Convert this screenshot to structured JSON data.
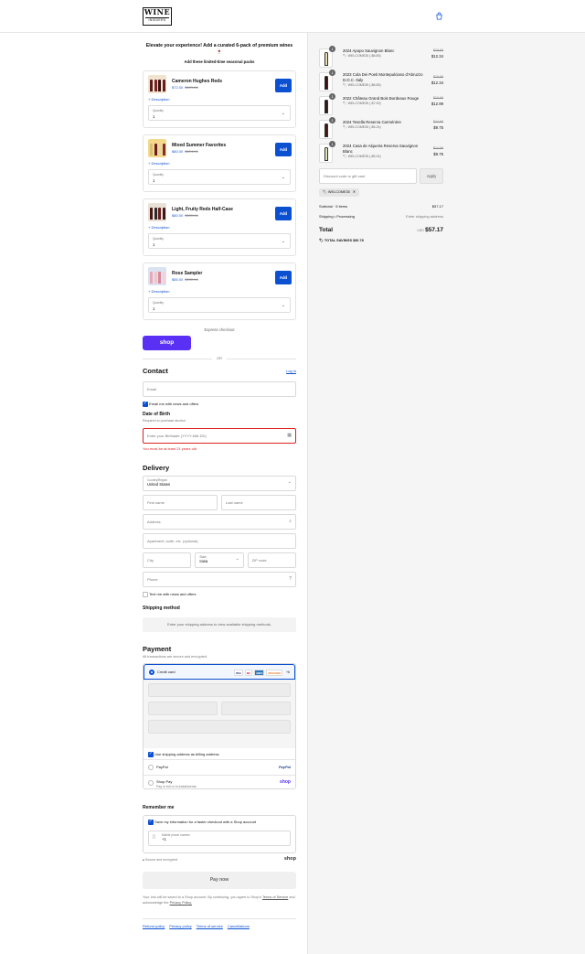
{
  "header": {
    "logo_top": "WINE",
    "logo_bottom": "INSIDERS"
  },
  "upsell": {
    "title": "Elevate your experience! Add a curated 6-pack of premium wines 🍷",
    "subtitle": "Add these limited-time seasonal packs",
    "products": [
      {
        "name": "Cameron Hughes Reds",
        "price": "$72.00",
        "compare": "$121.64",
        "add": "Add",
        "description": "Description",
        "qty_label": "Quantity",
        "qty": "1"
      },
      {
        "name": "Mixed Summer Favorites",
        "price": "$80.00",
        "compare": "$124.94",
        "add": "Add",
        "description": "Description",
        "qty_label": "Quantity",
        "qty": "1"
      },
      {
        "name": "Light, Fruity Reds Half-Case",
        "price": "$80.00",
        "compare": "$120.44",
        "add": "Add",
        "description": "Description",
        "qty_label": "Quantity",
        "qty": "1"
      },
      {
        "name": "Rose Sampler",
        "price": "$85.00",
        "compare": "$130.94",
        "add": "Add",
        "description": "Description",
        "qty_label": "Quantity",
        "qty": "1"
      }
    ]
  },
  "express": {
    "label": "Express checkout",
    "shop": "shop",
    "or": "OR"
  },
  "contact": {
    "title": "Contact",
    "login": "Log in",
    "email_placeholder": "Email",
    "news": "Email me with news and offers",
    "dob_title": "Date of Birth",
    "dob_sub": "Required to purchase alcohol",
    "dob_placeholder": "Enter your Birthdate (YYYY-MM-DD)",
    "dob_error": "You must be at least 21 years old"
  },
  "delivery": {
    "title": "Delivery",
    "country_label": "Country/Region",
    "country": "United States",
    "first": "First name",
    "last": "Last name",
    "address": "Address",
    "apt": "Apartment, suite, etc. (optional)",
    "city": "City",
    "state_label": "State",
    "state": "Iowa",
    "zip": "ZIP code",
    "phone": "Phone",
    "text_news": "Text me with news and offers",
    "ship_title": "Shipping method",
    "ship_msg": "Enter your shipping address to view available shipping methods."
  },
  "payment": {
    "title": "Payment",
    "sub": "All transactions are secure and encrypted.",
    "credit": "Credit card",
    "more": "+6",
    "billing": "Use shipping address as billing address",
    "paypal": "PayPal",
    "paypal_logo": "PayPal",
    "shoppay": "Shop Pay",
    "shoppay_sub": "Pay in full or in installments",
    "shoppay_logo": "shop",
    "cards": [
      "VISA",
      "MC",
      "AMEX",
      "DISCOVER"
    ]
  },
  "remember": {
    "title": "Remember me",
    "save": "Save my information for a faster checkout with a Shop account",
    "mobile_label": "Mobile phone number",
    "mobile_value": "+1",
    "secure": "Secure and encrypted",
    "shop": "shop",
    "pay": "Pay now",
    "legal_1": "Your info will be saved to a Shop account. By continuing, you agree to Shop's",
    "tos": "Terms of Service",
    "legal_2": "and acknowledge the",
    "privacy": "Privacy Policy."
  },
  "footer": [
    "Refund policy",
    "Privacy policy",
    "Terms of service",
    "Cancellations"
  ],
  "order": {
    "items": [
      {
        "qty": "1",
        "name": "2024 Apopo Sauvignon Blanc",
        "disc": "WELCOME35 (-$6.65)",
        "compare": "$18.99",
        "price": "$12.34"
      },
      {
        "qty": "1",
        "name": "2023 Cola Dei Poeti Montepulciano d'Abruzzo D.O.C. Italy",
        "disc": "WELCOME35 (-$6.65)",
        "compare": "$18.99",
        "price": "$12.34"
      },
      {
        "qty": "1",
        "name": "2022 Château Grand Bois Bordeaux Rouge",
        "disc": "WELCOME35 (-$7.00)",
        "compare": "$19.99",
        "price": "$12.99"
      },
      {
        "qty": "1",
        "name": "2024 Tesella Reserva Carménère",
        "disc": "WELCOME35 (-$5.24)",
        "compare": "$14.99",
        "price": "$9.75"
      },
      {
        "qty": "1",
        "name": "2024 Casa de Alqueria Reserva Sauvignon Blanc",
        "disc": "WELCOME35 (-$5.24)",
        "compare": "$14.99",
        "price": "$9.75"
      }
    ],
    "discount_placeholder": "Discount code or gift card",
    "apply": "Apply",
    "code": "WELCOME35",
    "subtotal_label": "Subtotal · 5 items",
    "subtotal": "$57.17",
    "shipping_label": "Shipping • Processing",
    "shipping": "Enter shipping address",
    "total_label": "Total",
    "currency": "USD",
    "total": "$57.17",
    "savings": "TOTAL SAVINGS",
    "savings_value": "$30.78"
  },
  "colors": {
    "accent": "#0b50d1",
    "shop": "#5a31f4",
    "error": "#dd2222"
  }
}
